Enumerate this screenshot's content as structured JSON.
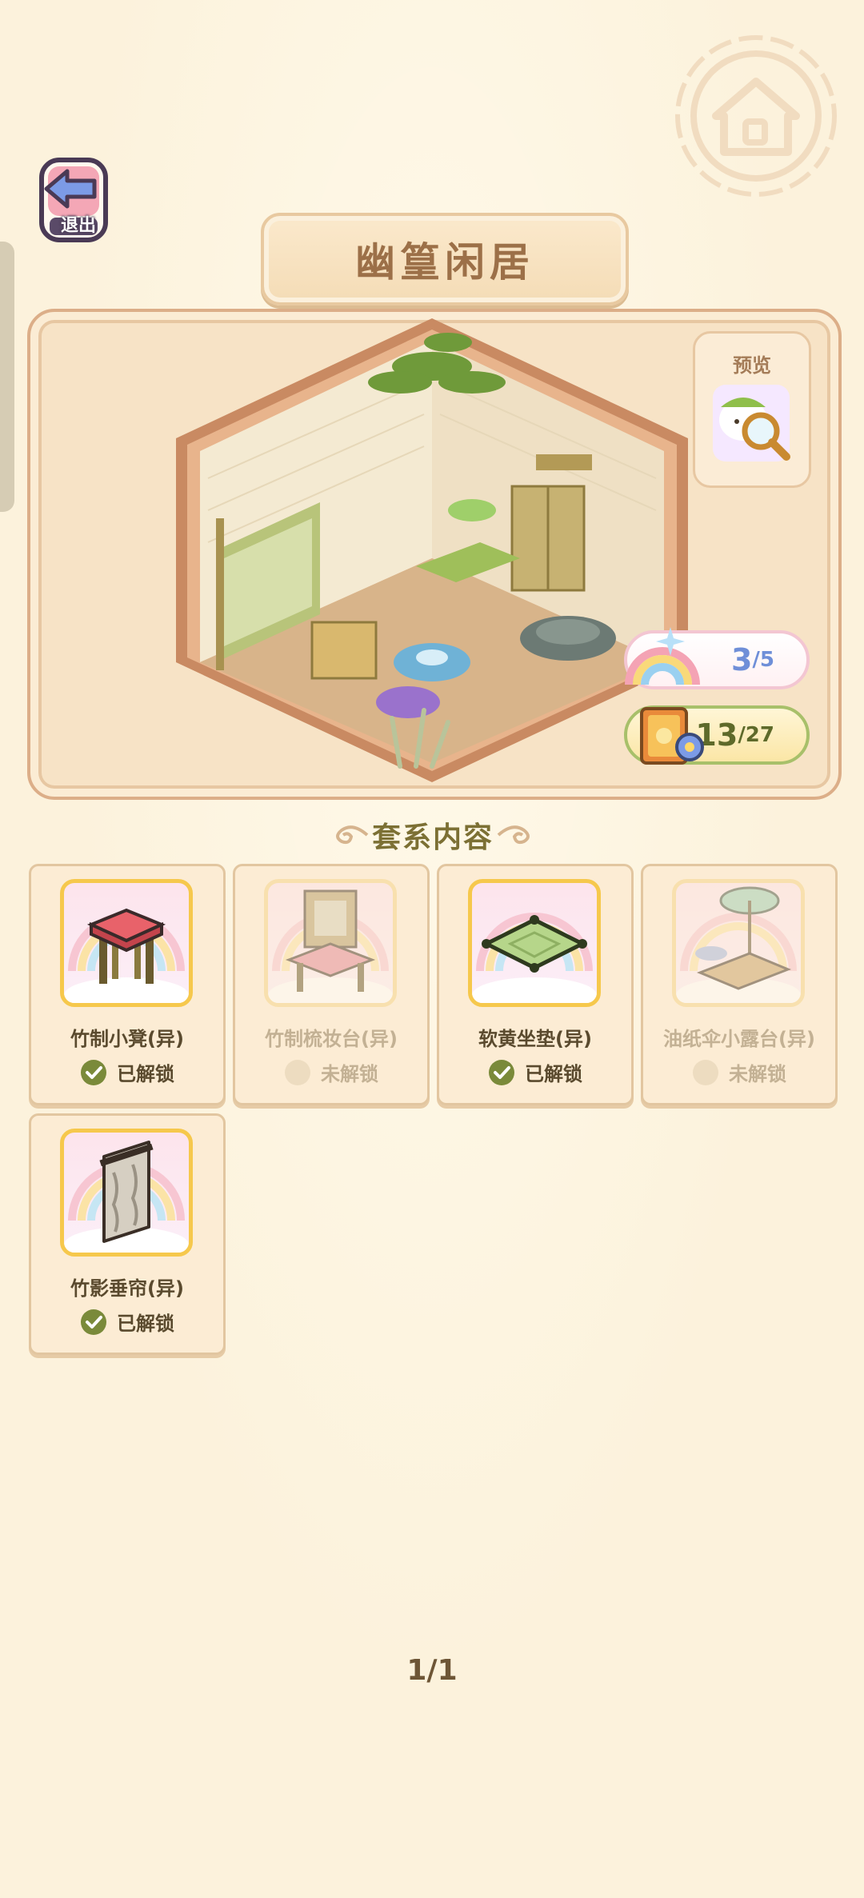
{
  "header": {
    "exit_label": "退出",
    "title": "幽篁闲居"
  },
  "preview": {
    "button_label": "预览",
    "rainbow_counter": {
      "current": "3",
      "total": "/5"
    },
    "collection_counter": {
      "current": "13",
      "total": "/27"
    }
  },
  "section": {
    "title": "套系内容"
  },
  "items": [
    {
      "name": "竹制小凳(异)",
      "status": "已解锁",
      "unlocked": true,
      "icon": "stool-icon"
    },
    {
      "name": "竹制梳妆台(异)",
      "status": "未解锁",
      "unlocked": false,
      "icon": "dresser-icon"
    },
    {
      "name": "软黄坐垫(异)",
      "status": "已解锁",
      "unlocked": true,
      "icon": "cushion-icon"
    },
    {
      "name": "油纸伞小露台(异)",
      "status": "未解锁",
      "unlocked": false,
      "icon": "umbrella-terrace-icon"
    },
    {
      "name": "竹影垂帘(异)",
      "status": "已解锁",
      "unlocked": true,
      "icon": "curtain-icon"
    }
  ],
  "pagination": {
    "label": "1/1"
  },
  "colors": {
    "background": "#fcf2dc",
    "unlocked_check": "#7a8a3a",
    "locked_dot": "#eddcc0",
    "title_text": "#9c7048",
    "rainbow_count": "#6f8fd8"
  }
}
